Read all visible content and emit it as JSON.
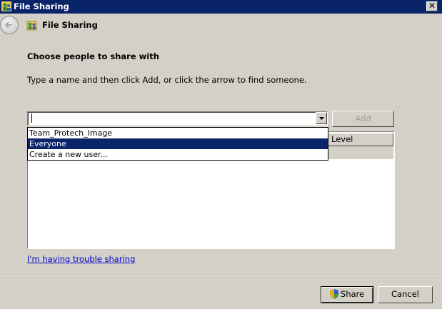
{
  "window": {
    "title": "File Sharing",
    "close_glyph": "✕",
    "icon": "sharing-people-icon"
  },
  "header": {
    "title": "File Sharing",
    "back_icon": "back-arrow-icon",
    "icon": "sharing-people-icon"
  },
  "main": {
    "heading": "Choose people to share with",
    "instructions": "Type a name and then click Add, or click the arrow to find someone.",
    "name_input": {
      "value": "",
      "placeholder": ""
    },
    "add_button": "Add",
    "dropdown_options": [
      {
        "label": "Team_Protech_Image",
        "selected": false
      },
      {
        "label": "Everyone",
        "selected": true
      },
      {
        "label": "Create a new user...",
        "selected": false
      }
    ],
    "list": {
      "column_header": "Level"
    },
    "trouble_link": "I'm having trouble sharing"
  },
  "footer": {
    "share_button": "Share",
    "cancel_button": "Cancel",
    "share_icon": "uac-shield-icon"
  },
  "colors": {
    "title_bar": "#0a246a",
    "selection": "#0a246a",
    "face": "#d4d0c8",
    "link": "#0000cc"
  }
}
